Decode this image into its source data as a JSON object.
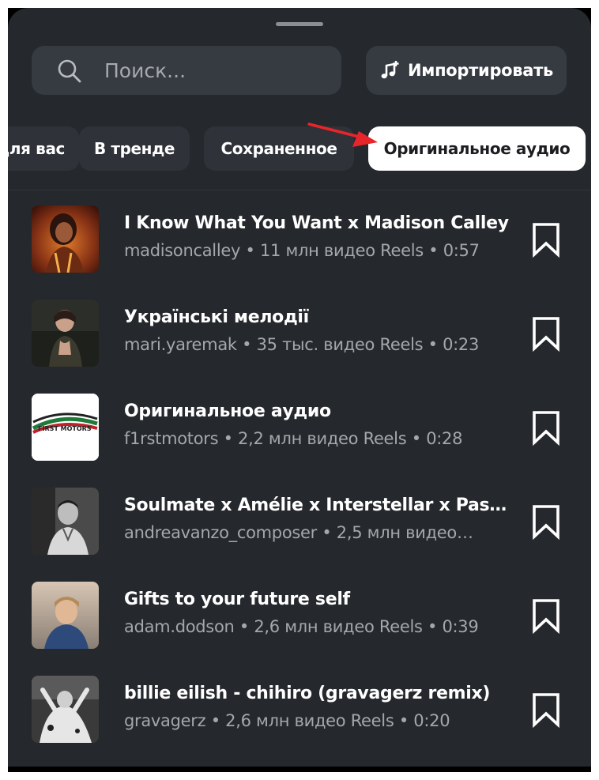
{
  "header": {
    "search_placeholder": "Поиск...",
    "import_label": "Импортировать"
  },
  "chips": [
    {
      "label": "Для вас",
      "active": false
    },
    {
      "label": "В тренде",
      "active": false
    },
    {
      "label": "Сохраненное",
      "active": false
    },
    {
      "label": "Оригинальное аудио",
      "active": true
    }
  ],
  "annotation": {
    "arrow_color": "#e8252b"
  },
  "tracks": [
    {
      "title": "I Know What You Want x Madison Calley",
      "meta": "madisoncalley • 11 млн видео Reels • 0:57"
    },
    {
      "title": "Українські мелодії",
      "meta": "mari.yaremak • 35 тыс. видео Reels • 0:23"
    },
    {
      "title": "Оригинальное аудио",
      "meta": "f1rstmotors • 2,2 млн видео Reels • 0:28",
      "thumb_text": "FIRST MOTORS"
    },
    {
      "title": "Soulmate x Amélie x Interstellar x Passa…",
      "meta": "andreavanzo_composer • 2,5 млн видео…"
    },
    {
      "title": "Gifts to your future self",
      "meta": "adam.dodson • 2,6 млн видео Reels • 0:39"
    },
    {
      "title": "billie eilish - chihiro (gravagerz remix)",
      "meta": "gravagerz • 2,6 млн видео Reels • 0:20"
    }
  ],
  "colors": {
    "sheet_bg": "#25282c",
    "field_bg": "#363a41",
    "chip_bg": "#2f3238",
    "active_chip_bg": "#ffffff",
    "secondary_text": "#a4a7ac"
  }
}
